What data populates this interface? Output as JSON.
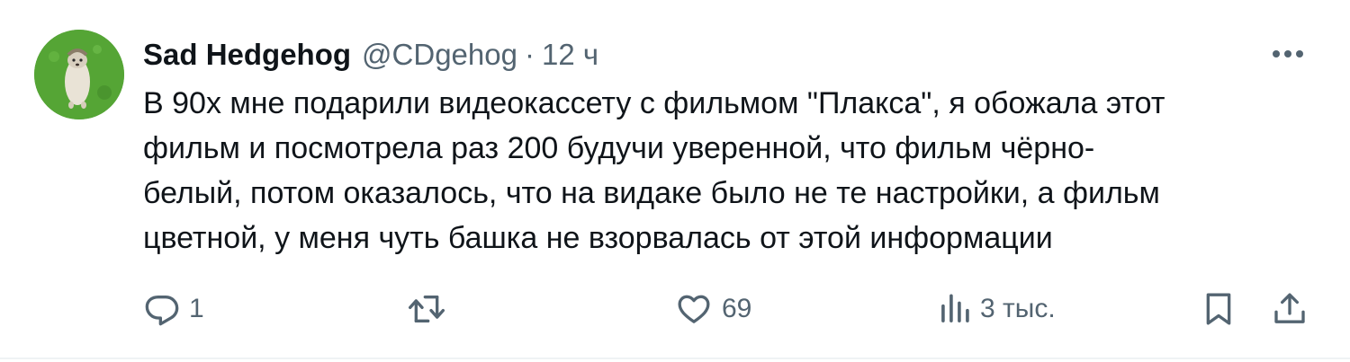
{
  "tweet": {
    "author_name": "Sad Hedgehog",
    "handle": "@CDgehog",
    "separator": "·",
    "time": "12 ч",
    "text_lines": [
      "В 90х мне подарили видеокассету с фильмом \"Плакса\", я обожала этот",
      "фильм и посмотрела раз 200 будучи уверенной, что фильм чёрно-",
      "белый, потом оказалось, что на видаке было не те настройки, а фильм",
      "цветной, у меня чуть башка не взорвалась от этой информации"
    ]
  },
  "actions": {
    "reply_count": "1",
    "retweet_count": "",
    "like_count": "69",
    "views_count": "3 тыс."
  },
  "icons": {
    "avatar": "hedgehog-avatar",
    "more": "more-icon",
    "reply": "reply-icon",
    "retweet": "retweet-icon",
    "like": "heart-icon",
    "views": "views-icon",
    "bookmark": "bookmark-icon",
    "share": "share-icon"
  },
  "colors": {
    "text": "#0f1419",
    "secondary": "#536471",
    "divider": "#eff3f4"
  }
}
